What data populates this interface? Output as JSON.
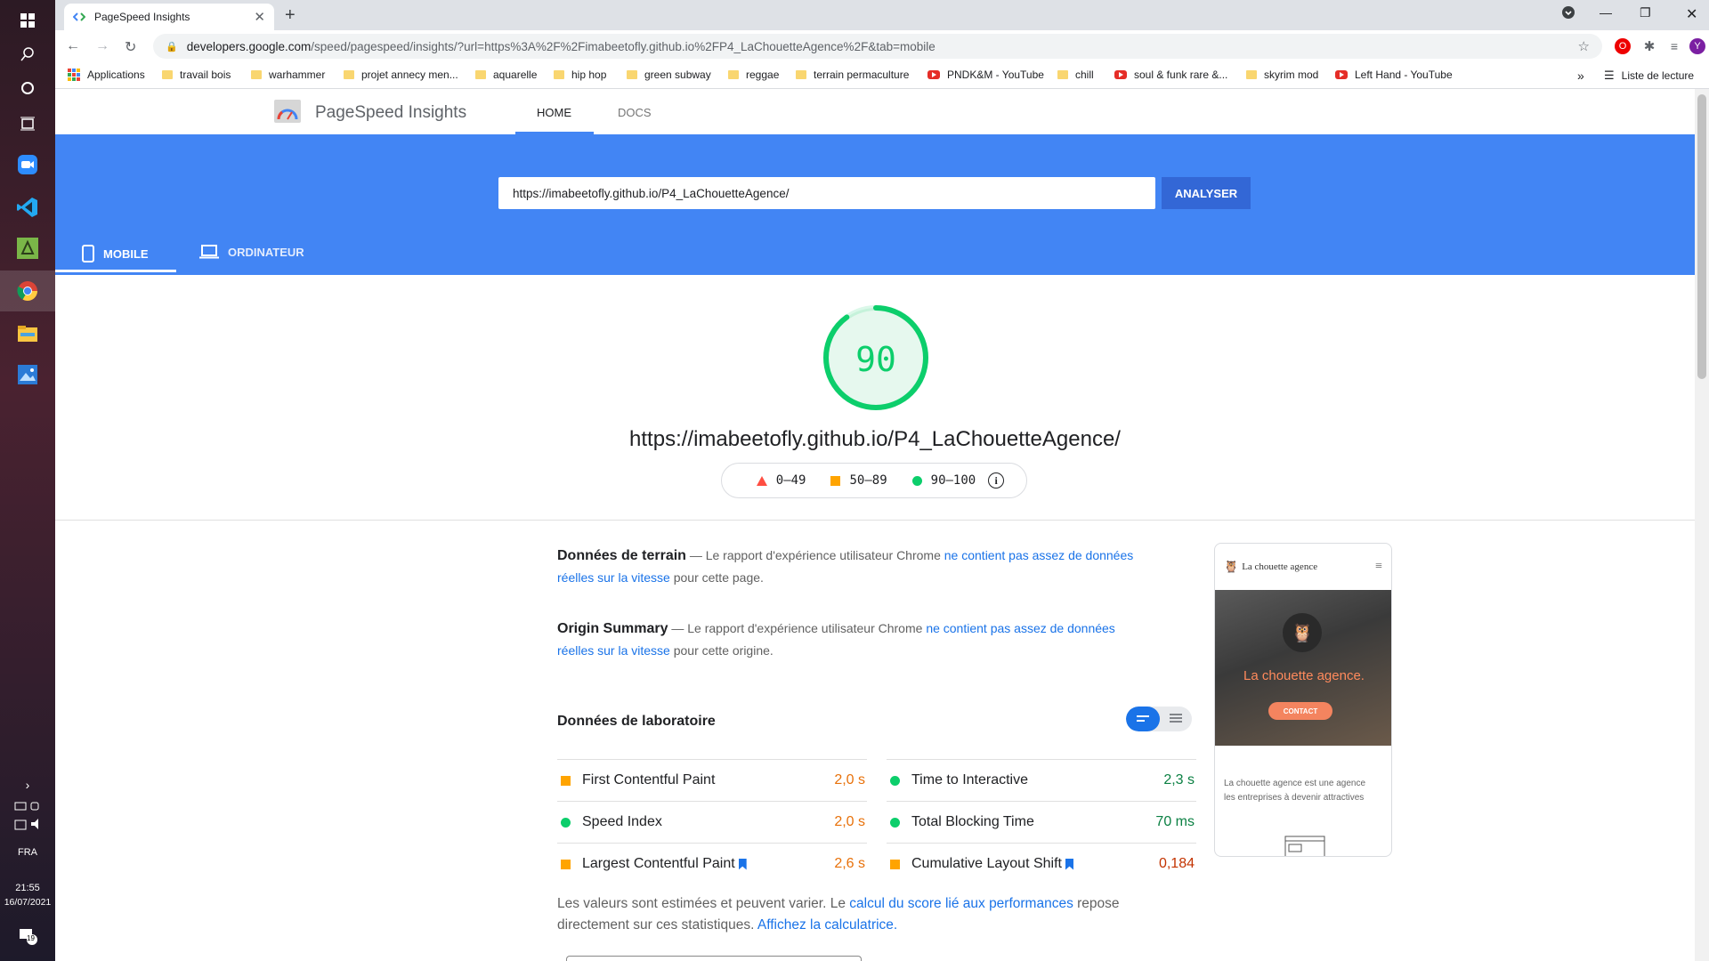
{
  "taskbar": {
    "language": "FRA",
    "time": "21:55",
    "date": "16/07/2021",
    "notifications_count": "19"
  },
  "browser": {
    "tab_title": "PageSpeed Insights",
    "address": {
      "host": "developers.google.com",
      "path": "/speed/pagespeed/insights/?url=https%3A%2F%2Fimabeetofly.github.io%2FP4_LaChouetteAgence%2F&tab=mobile"
    },
    "profile_initial": "Y",
    "bookmarks": [
      {
        "label": "Applications",
        "icon": "apps-icon"
      },
      {
        "label": "travail bois",
        "icon": "folder-icon"
      },
      {
        "label": "warhammer",
        "icon": "folder-icon"
      },
      {
        "label": "projet annecy men...",
        "icon": "folder-icon"
      },
      {
        "label": "aquarelle",
        "icon": "folder-icon"
      },
      {
        "label": "hip hop",
        "icon": "folder-icon"
      },
      {
        "label": "green subway",
        "icon": "folder-icon"
      },
      {
        "label": "reggae",
        "icon": "folder-icon"
      },
      {
        "label": "terrain permaculture",
        "icon": "folder-icon"
      },
      {
        "label": "PNDK&M - YouTube",
        "icon": "youtube-icon"
      },
      {
        "label": "chill",
        "icon": "folder-icon"
      },
      {
        "label": "soul & funk rare &...",
        "icon": "youtube-icon"
      },
      {
        "label": "skyrim mod",
        "icon": "folder-icon"
      },
      {
        "label": "Left Hand - YouTube",
        "icon": "youtube-icon"
      }
    ],
    "overflow_label": "»",
    "reading_list": "Liste de lecture"
  },
  "psi": {
    "title": "PageSpeed Insights",
    "nav": {
      "home": "HOME",
      "docs": "DOCS"
    },
    "url_value": "https://imabeetofly.github.io/P4_LaChouetteAgence/",
    "analyze_label": "ANALYSER",
    "device_tabs": {
      "mobile": "MOBILE",
      "desktop": "ORDINATEUR"
    },
    "score": "90",
    "score_fraction": 0.9,
    "tested_url": "https://imabeetofly.github.io/P4_LaChouetteAgence/",
    "legend": {
      "fail": "0–49",
      "average": "50–89",
      "pass": "90–100"
    },
    "field_data": {
      "title": "Données de terrain",
      "text_before": " — Le rapport d'expérience utilisateur Chrome ",
      "link": "ne contient pas assez de données réelles sur la vitesse",
      "text_after": " pour cette page."
    },
    "origin_summary": {
      "title": "Origin Summary",
      "text_before": " — Le rapport d'expérience utilisateur Chrome ",
      "link": "ne contient pas assez de données réelles sur la vitesse",
      "text_after": " pour cette origine."
    },
    "lab_title": "Données de laboratoire",
    "metrics_left": [
      {
        "name": "First Contentful Paint",
        "value": "2,0 s",
        "status": "average"
      },
      {
        "name": "Speed Index",
        "value": "2,0 s",
        "status": "pass"
      },
      {
        "name": "Largest Contentful Paint",
        "value": "2,6 s",
        "status": "average",
        "flag": true
      }
    ],
    "metrics_right": [
      {
        "name": "Time to Interactive",
        "value": "2,3 s",
        "status": "pass"
      },
      {
        "name": "Total Blocking Time",
        "value": "70 ms",
        "status": "pass"
      },
      {
        "name": "Cumulative Layout Shift",
        "value": "0,184",
        "status": "average",
        "flag": true
      }
    ],
    "footnote": {
      "t1": "Les valeurs sont estimées et peuvent varier. Le ",
      "l1": "calcul du score lié aux performances",
      "t2": " repose directement sur ces statistiques. ",
      "l2": "Affichez la calculatrice."
    },
    "preview": {
      "brand": "La chouette agence",
      "hero_title": "La chouette agence.",
      "contact": "CONTACT",
      "body_line1": "La chouette agence est une agence",
      "body_line2": "les entreprises à devenir attractives"
    }
  },
  "colors": {
    "pass": "#0cce6b",
    "average": "#ffa400",
    "fail": "#ff4e42",
    "header_blue": "#4285f4"
  }
}
